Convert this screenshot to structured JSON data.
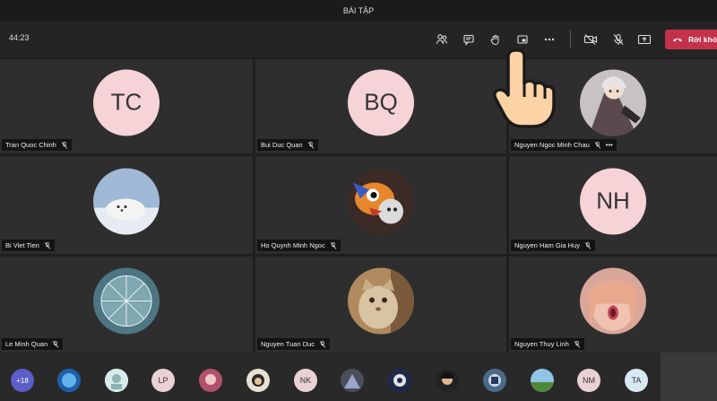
{
  "window": {
    "title": "BÀI TẬP"
  },
  "toolbar": {
    "timer": "44:23",
    "leave_label": "Rời khỏ",
    "icons": [
      "participants-icon",
      "chat-icon",
      "raise-hand-icon",
      "share-tray-icon",
      "more-icon",
      "camera-off-icon",
      "mic-off-icon",
      "share-screen-icon",
      "phone-hangup-icon"
    ]
  },
  "participants": [
    {
      "name": "Tran Quoc Chinh",
      "initials": "TC",
      "avatar": "initials"
    },
    {
      "name": "Bui Duc Quan",
      "initials": "BQ",
      "avatar": "initials"
    },
    {
      "name": "Nguyen Ngoc Minh Chau",
      "initials": "",
      "avatar": "photo"
    },
    {
      "name": "Bi Viet Tien",
      "initials": "",
      "avatar": "photo"
    },
    {
      "name": "Ho Quynh Minh Ngoc",
      "initials": "",
      "avatar": "photo"
    },
    {
      "name": "Nguyen Ham Gia Huy",
      "initials": "NH",
      "avatar": "initials"
    },
    {
      "name": "Le Minh Quan",
      "initials": "",
      "avatar": "photo"
    },
    {
      "name": "Nguyen Tuan Duc",
      "initials": "",
      "avatar": "photo"
    },
    {
      "name": "Nguyen Thuy Linh",
      "initials": "",
      "avatar": "photo"
    }
  ],
  "tile_more": "•••",
  "bottom_bar": {
    "overflow": "+18",
    "initials": {
      "a": "LP",
      "b": "NK",
      "c": "NM",
      "d": "TA"
    }
  },
  "colors": {
    "leave": "#c4314b",
    "initials_bg": "#f6d3d6",
    "overflow_bg": "#5b5fc7"
  }
}
